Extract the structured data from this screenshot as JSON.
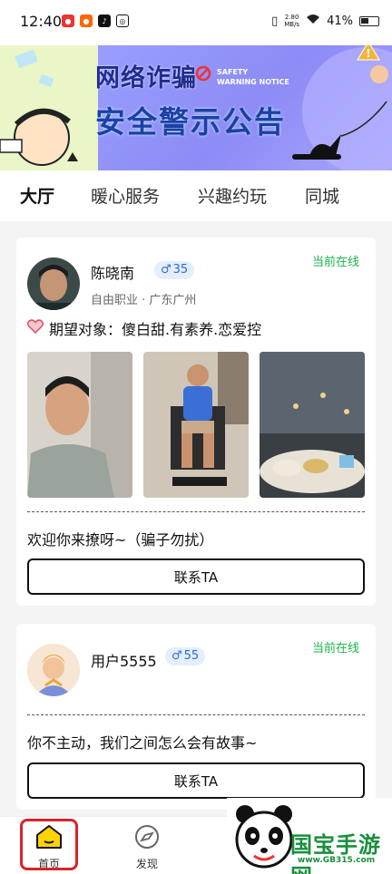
{
  "status_bar": {
    "time": "12:40",
    "net_speed_value": "2.80",
    "net_speed_unit": "MB/s",
    "battery": "41%"
  },
  "banner": {
    "title_line1": "网络诈骗",
    "title_line2": "安全警示公告",
    "subtitle_line1": "SAFETY",
    "subtitle_line2": "WARNING NOTICE",
    "accent_color": "#1e3fa8"
  },
  "tabs": [
    {
      "label": "大厅",
      "active": true
    },
    {
      "label": "暖心服务",
      "active": false
    },
    {
      "label": "兴趣约玩",
      "active": false
    },
    {
      "label": "同城",
      "active": false
    }
  ],
  "cards": [
    {
      "name": "陈晓南",
      "gender_symbol": "♂",
      "age": "35",
      "meta": "自由职业 · 广东广州",
      "status": "当前在线",
      "expect": "期望对象：傻白甜.有素养.恋爱控",
      "greeting": "欢迎你来撩呀~（骗子勿扰）",
      "contact_label": "联系TA"
    },
    {
      "name": "用户5555",
      "gender_symbol": "♂",
      "age": "55",
      "status": "当前在线",
      "greeting": "你不主动，我们之间怎么会有故事~",
      "contact_label": "联系TA"
    }
  ],
  "bottom_nav": [
    {
      "label": "首页",
      "icon": "home-icon",
      "active": true
    },
    {
      "label": "发现",
      "icon": "compass-icon",
      "active": false
    }
  ],
  "watermark": {
    "title": "国宝手游网",
    "url": "www.GB315.com"
  },
  "colors": {
    "tab_underline": "#ffd400",
    "online": "#1bb54b",
    "badge_text": "#2b6bd6",
    "highlight": "#d8232a"
  }
}
